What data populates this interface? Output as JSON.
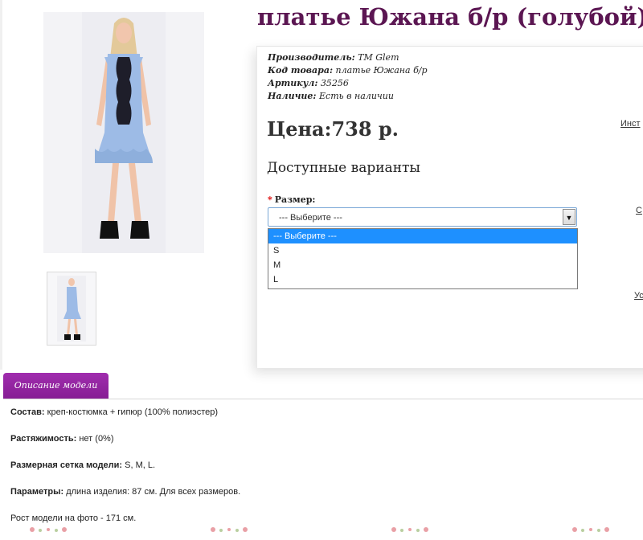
{
  "product": {
    "title": "платье Южана б/р (голубой)",
    "specs": [
      {
        "label": "Производитель:",
        "value": "TM Glem"
      },
      {
        "label": "Код товара:",
        "value": "платье Южана б/р"
      },
      {
        "label": "Артикул:",
        "value": "35256"
      },
      {
        "label": "Наличие:",
        "value": "Есть в наличии"
      }
    ],
    "price": "Цена:738 р."
  },
  "options": {
    "heading": "Доступные варианты",
    "size_label": "Размер:",
    "required_mark": "*",
    "size_select": {
      "value": "--- Выберите ---",
      "options": [
        "--- Выберите ---",
        "S",
        "M",
        "L"
      ],
      "highlighted": "--- Выберите ---"
    }
  },
  "side_links": [
    "Инст",
    "С",
    "Ус"
  ],
  "tabs": {
    "description": "Описание модели"
  },
  "description": [
    {
      "label": "Состав:",
      "value": "креп-костюмка + гипюр (100% полиэстер)"
    },
    {
      "label": "Растяжимость:",
      "value": "нет (0%)"
    },
    {
      "label": "Размерная сетка модели:",
      "value": "S, M, L."
    },
    {
      "label": "Параметры:",
      "value": "длина изделия: 87 см. Для всех размеров."
    },
    {
      "label": "",
      "value": "Рост модели на фото - 171 см."
    }
  ],
  "colors": {
    "title": "#5b1652",
    "tab": "#8e2298",
    "dress": "#9dbbe6",
    "highlight": "#1e90ff"
  }
}
